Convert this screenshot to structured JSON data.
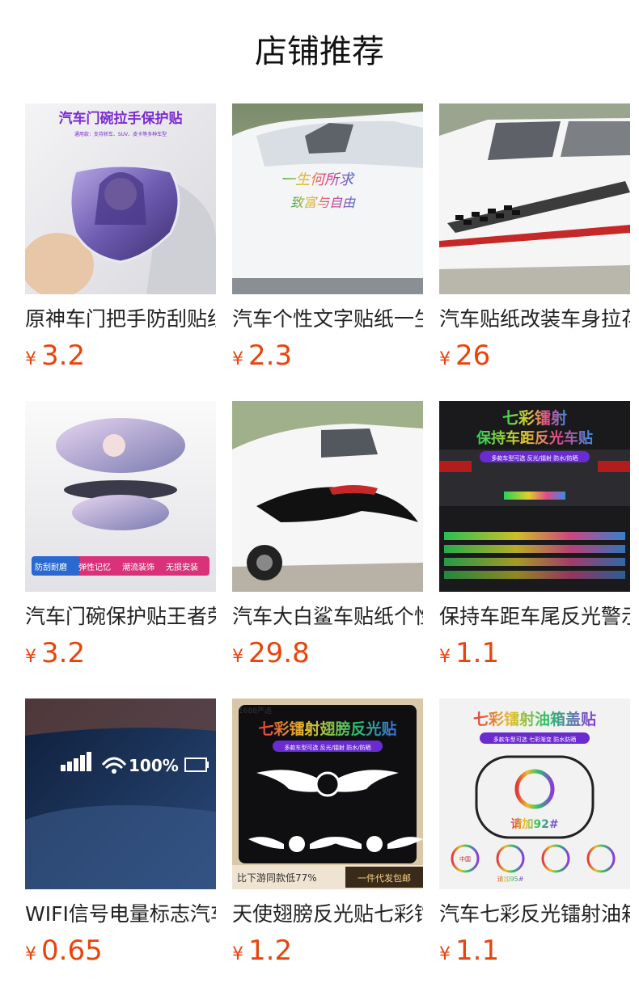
{
  "page": {
    "title": "店铺推荐"
  },
  "colors": {
    "price": "#e8440b",
    "title": "#111111",
    "name": "#222222"
  },
  "currency": "¥",
  "products": [
    {
      "name": "原神车门把手防刮贴纸",
      "price": "3.2",
      "image_text": [
        "汽车门碗拉手保护贴",
        "通用款：支持轿车、SUV、皮卡等多种车型"
      ]
    },
    {
      "name": "汽车个性文字贴纸一生何所求",
      "price": "2.3",
      "image_text": [
        "一生何所求",
        "致富与自由"
      ]
    },
    {
      "name": "汽车贴纸改装车身拉花",
      "price": "26",
      "image_text": []
    },
    {
      "name": "汽车门碗保护贴王者荣耀",
      "price": "3.2",
      "image_text": [
        "防刮耐磨",
        "弹性记忆",
        "潮流装饰",
        "无损安装"
      ]
    },
    {
      "name": "汽车大白鲨车贴纸个性",
      "price": "29.8",
      "image_text": []
    },
    {
      "name": "保持车距车尾反光警示贴",
      "price": "1.1",
      "image_text": [
        "七彩镭射",
        "保持车距反光车贴",
        "多款车型可选 反光/镭射 防水/防晒"
      ]
    },
    {
      "name": "WIFI信号电量标志汽车贴",
      "price": "0.65",
      "image_text": [
        "100%"
      ]
    },
    {
      "name": "天使翅膀反光贴七彩镭射",
      "price": "1.2",
      "image_text": [
        "1688严选",
        "七彩镭射翅膀反光贴",
        "多款车型可选 反光/镭射 防水/防晒",
        "比下游同款低77%",
        "一件代发包邮"
      ]
    },
    {
      "name": "汽车七彩反光镭射油箱盖贴",
      "price": "1.1",
      "image_text": [
        "七彩镭射油箱盖贴",
        "多款车型可选 七彩渐变 防水防晒",
        "请加92#",
        "中国",
        "请加95#"
      ]
    }
  ]
}
